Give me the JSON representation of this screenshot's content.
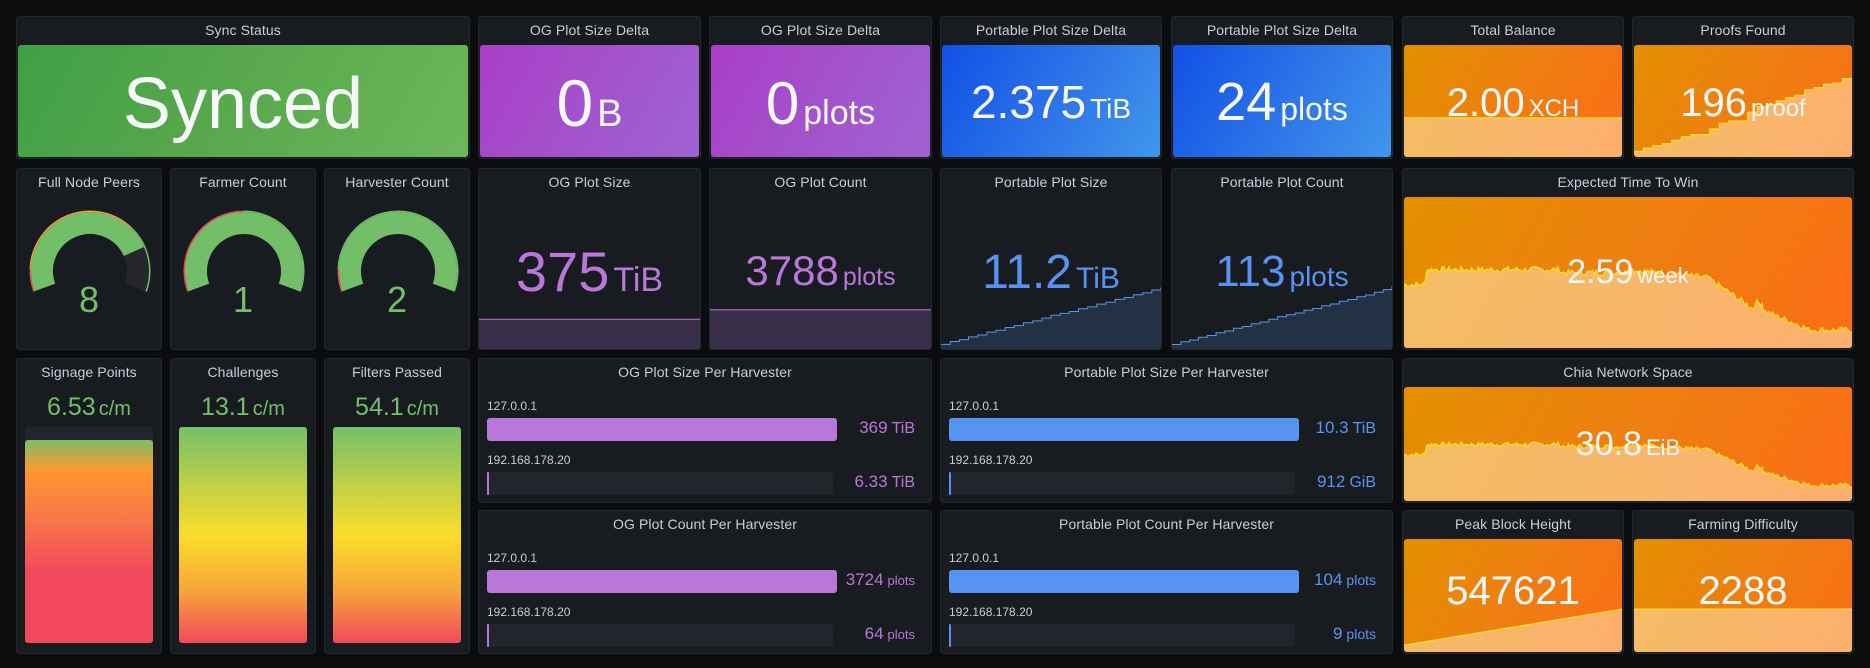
{
  "colors": {
    "green": "#73bf69",
    "purple": "#b877d9",
    "blue": "#5794f2",
    "red": "#f2495c",
    "orange": "#ff9830",
    "yellow": "#fade2a",
    "spark_line": "#fade2a"
  },
  "row1": {
    "sync_status": {
      "title": "Sync Status",
      "value": "Synced"
    },
    "og_size_delta": {
      "title": "OG Plot Size Delta",
      "value": "0",
      "unit": "B"
    },
    "og_count_delta": {
      "title": "OG Plot Size Delta",
      "value": "0",
      "unit": "plots"
    },
    "portable_size_delta": {
      "title": "Portable Plot Size Delta",
      "value": "2.375",
      "unit": "TiB"
    },
    "portable_count_delta": {
      "title": "Portable Plot Size Delta",
      "value": "24",
      "unit": "plots"
    },
    "total_balance": {
      "title": "Total Balance",
      "value": "2.00",
      "unit": "XCH",
      "trend": [
        0.35,
        0.35,
        0.35,
        0.35,
        0.35,
        0.35,
        0.35,
        0.35
      ]
    },
    "proofs_found": {
      "title": "Proofs Found",
      "value": "196",
      "unit": "proof",
      "trend": [
        0.05,
        0.08,
        0.1,
        0.12,
        0.15,
        0.18,
        0.2,
        0.2,
        0.25,
        0.3,
        0.32,
        0.32,
        0.4,
        0.45,
        0.47,
        0.5,
        0.53,
        0.55,
        0.6,
        0.62,
        0.65,
        0.66,
        0.7,
        0.72
      ]
    }
  },
  "row2": {
    "full_node_peers": {
      "title": "Full Node Peers",
      "value": "8",
      "fraction": 0.8,
      "thresholds": [
        "red",
        "orange",
        "green"
      ]
    },
    "farmer_count": {
      "title": "Farmer Count",
      "value": "1",
      "fraction": 1.0,
      "thresholds": [
        "red",
        "green"
      ]
    },
    "harvester_count": {
      "title": "Harvester Count",
      "value": "2",
      "fraction": 1.0,
      "thresholds": [
        "red",
        "green"
      ]
    },
    "og_plot_size": {
      "title": "OG Plot Size",
      "value": "375",
      "unit": "TiB",
      "trend_level": 0.22
    },
    "og_plot_count": {
      "title": "OG Plot Count",
      "value": "3788",
      "unit": "plots",
      "trend_level": 0.33
    },
    "portable_plot_size": {
      "title": "Portable Plot Size",
      "value": "11.2",
      "unit": "TiB",
      "trend": [
        0.05,
        0.08,
        0.1,
        0.13,
        0.15,
        0.18,
        0.2,
        0.23,
        0.25,
        0.28,
        0.3,
        0.33,
        0.36,
        0.38,
        0.4,
        0.43,
        0.45,
        0.48,
        0.5,
        0.53,
        0.55,
        0.58,
        0.6,
        0.63,
        0.66
      ]
    },
    "portable_plot_count": {
      "title": "Portable Plot Count",
      "value": "113",
      "unit": "plots",
      "trend": [
        0.05,
        0.08,
        0.1,
        0.13,
        0.15,
        0.18,
        0.2,
        0.23,
        0.25,
        0.28,
        0.3,
        0.33,
        0.36,
        0.38,
        0.4,
        0.43,
        0.45,
        0.48,
        0.5,
        0.53,
        0.55,
        0.58,
        0.6,
        0.63,
        0.66,
        0.7
      ]
    },
    "expected_time": {
      "title": "Expected Time To Win",
      "value": "2.59",
      "unit": "week"
    }
  },
  "row3": {
    "signage_points": {
      "title": "Signage Points",
      "value": "6.53",
      "unit": "c/m",
      "fraction": 0.94
    },
    "challenges": {
      "title": "Challenges",
      "value": "13.1",
      "unit": "c/m",
      "fraction": 1.0
    },
    "filters_passed": {
      "title": "Filters Passed",
      "value": "54.1",
      "unit": "c/m",
      "fraction": 1.0
    },
    "og_size_per_harvester": {
      "title": "OG Plot Size Per Harvester",
      "rows": [
        {
          "label": "127.0.0.1",
          "value": "369",
          "unit": "TiB",
          "fraction": 1.0
        },
        {
          "label": "192.168.178.20",
          "value": "6.33",
          "unit": "TiB",
          "fraction": 0.0
        }
      ]
    },
    "portable_size_per_harvester": {
      "title": "Portable Plot Size Per Harvester",
      "rows": [
        {
          "label": "127.0.0.1",
          "value": "10.3",
          "unit": "TiB",
          "fraction": 1.0
        },
        {
          "label": "192.168.178.20",
          "value": "912",
          "unit": "GiB",
          "fraction": 0.0
        }
      ]
    },
    "og_count_per_harvester": {
      "title": "OG Plot Count Per Harvester",
      "rows": [
        {
          "label": "127.0.0.1",
          "value": "3724",
          "unit": "plots",
          "fraction": 1.0
        },
        {
          "label": "192.168.178.20",
          "value": "64",
          "unit": "plots",
          "fraction": 0.0
        }
      ]
    },
    "portable_count_per_harvester": {
      "title": "Portable Plot Count Per Harvester",
      "rows": [
        {
          "label": "127.0.0.1",
          "value": "104",
          "unit": "plots",
          "fraction": 1.0
        },
        {
          "label": "192.168.178.20",
          "value": "9",
          "unit": "plots",
          "fraction": 0.0
        }
      ]
    },
    "network_space": {
      "title": "Chia Network Space",
      "value": "30.8",
      "unit": "EiB"
    },
    "peak_block_height": {
      "title": "Peak Block Height",
      "value": "547621"
    },
    "farming_difficulty": {
      "title": "Farming Difficulty",
      "value": "2288"
    }
  }
}
